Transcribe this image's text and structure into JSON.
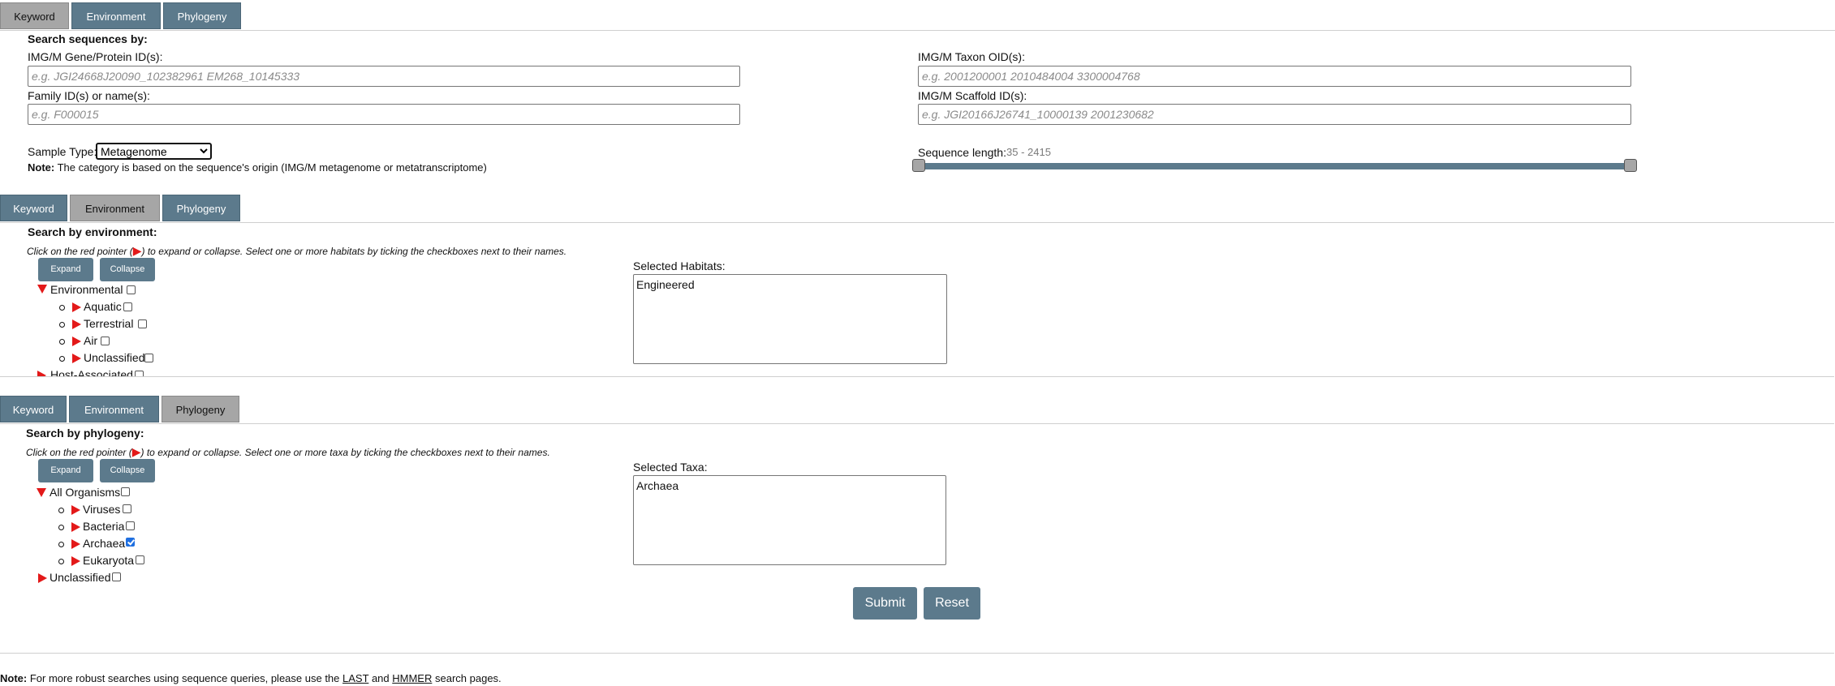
{
  "tabs": [
    "Keyword",
    "Environment",
    "Phylogeny"
  ],
  "keyword": {
    "title": "Search sequences by:",
    "gene_label": "IMG/M Gene/Protein ID(s):",
    "gene_placeholder": "e.g. JGI24668J20090_102382961 EM268_10145333",
    "family_label": "Family ID(s) or name(s):",
    "family_placeholder": "e.g. F000015",
    "taxon_label": "IMG/M Taxon OID(s):",
    "taxon_placeholder": "e.g. 2001200001 2010484004 3300004768",
    "scaffold_label": "IMG/M Scaffold ID(s):",
    "scaffold_placeholder": "e.g. JGI20166J26741_10000139 2001230682",
    "sample_type_label": "Sample Type:",
    "sample_type_value": "Metagenome",
    "note_bold": "Note:",
    "note_text": "The category is based on the sequence's origin (IMG/M metagenome or metatranscriptome)",
    "seq_length_label": "Sequence length:",
    "seq_length_value": "35 - 2415"
  },
  "environment": {
    "title": "Search by environment:",
    "hint_pre": "Click on the red pointer (",
    "hint_post": ") to expand or collapse. Select one or more habitats by ticking the checkboxes next to their names.",
    "expand_label": "Expand",
    "collapse_label": "Collapse",
    "root": "Environmental",
    "children": [
      "Aquatic",
      "Terrestrial",
      "Air",
      "Unclassified"
    ],
    "next_root": "Host-Associated",
    "selected_label": "Selected Habitats:",
    "selected_value": "Engineered"
  },
  "phylogeny": {
    "title": "Search by phylogeny:",
    "hint_pre": "Click on the red pointer (",
    "hint_post": ") to expand or collapse. Select one or more taxa by ticking the checkboxes next to their names.",
    "expand_label": "Expand",
    "collapse_label": "Collapse",
    "root": "All Organisms",
    "children": [
      "Viruses",
      "Bacteria",
      "Archaea",
      "Eukaryota"
    ],
    "checked_child": "Archaea",
    "other_root": "Unclassified",
    "selected_label": "Selected Taxa:",
    "selected_value": "Archaea"
  },
  "actions": {
    "submit": "Submit",
    "reset": "Reset"
  },
  "footer": {
    "note_bold": "Note:",
    "text_pre": "For more robust searches using sequence queries, please use the",
    "link1": "LAST",
    "and": "and",
    "link2": "HMMER",
    "text_post": "search pages."
  },
  "colors": {
    "tab": "#5c7a8c",
    "tab_active": "#a6a6a6",
    "pointer": "#e31919"
  }
}
